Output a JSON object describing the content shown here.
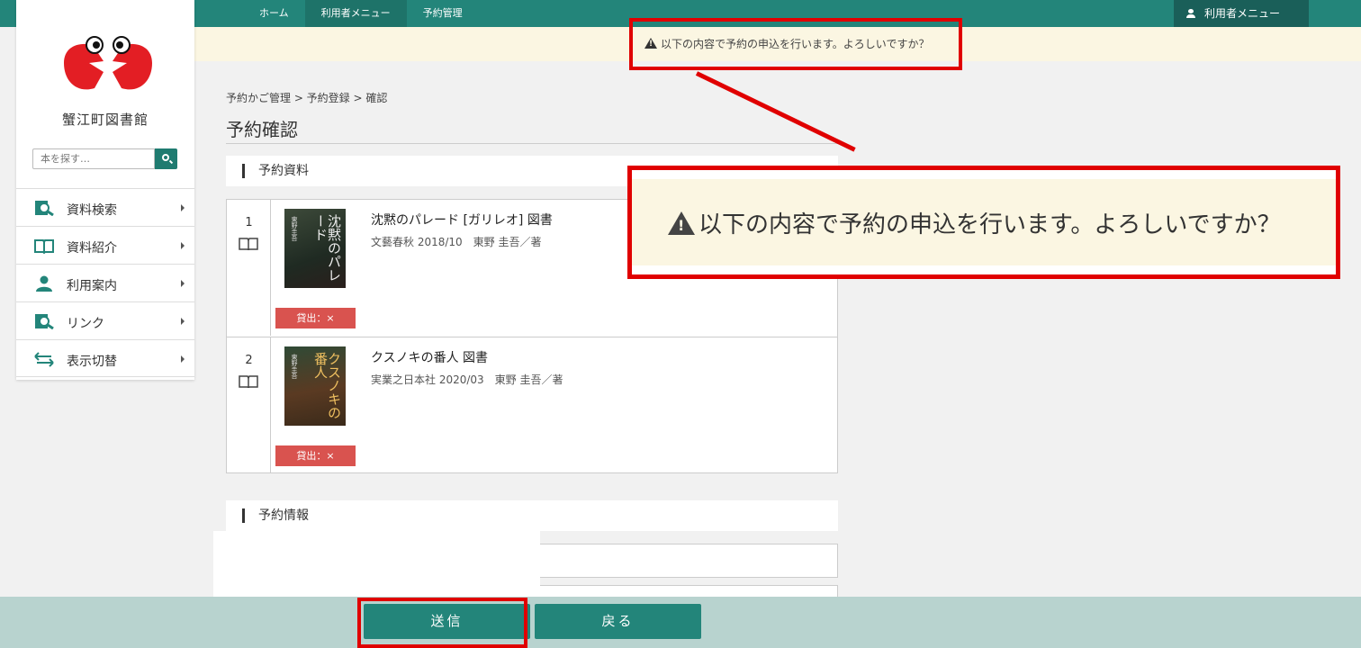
{
  "nav_breadcrumbs": [
    "ホーム",
    "利用者メニュー",
    "予約管理"
  ],
  "user_menu_label": "利用者メニュー",
  "confirm_message": "以下の内容で予約の申込を行います。よろしいですか？",
  "library_name": "蟹江町図書館",
  "search": {
    "placeholder": "本を探す…"
  },
  "sidebar": {
    "items": [
      {
        "label": "資料検索",
        "icon": "search-book-icon"
      },
      {
        "label": "資料紹介",
        "icon": "open-book-icon"
      },
      {
        "label": "利用案内",
        "icon": "user-icon"
      },
      {
        "label": "リンク",
        "icon": "search-book-icon"
      },
      {
        "label": "表示切替",
        "icon": "swap-arrows-icon"
      }
    ]
  },
  "breadcrumb": "予約かご管理 > 予約登録 > 確認",
  "page_title": "予約確認",
  "section_materials": "予約資料",
  "section_info": "予約情報",
  "items": [
    {
      "num": "1",
      "title": "沈黙のパレード [ガリレオ] 図書",
      "meta": "文藝春秋 2018/10　東野 圭吾／著",
      "status": "貸出：×",
      "cover_title": "沈黙のパレード",
      "cover_author": "東野圭吾"
    },
    {
      "num": "2",
      "title": "クスノキの番人 図書",
      "meta": "実業之日本社 2020/03　東野 圭吾／著",
      "status": "貸出：×",
      "cover_title": "クスノキの番人",
      "cover_author": "東野圭吾"
    }
  ],
  "buttons": {
    "send": "送信",
    "back": "戻る"
  },
  "colors": {
    "primary": "#23857a",
    "highlight": "#e00000",
    "banner": "#fbf6e2",
    "badge": "#d9534f"
  }
}
